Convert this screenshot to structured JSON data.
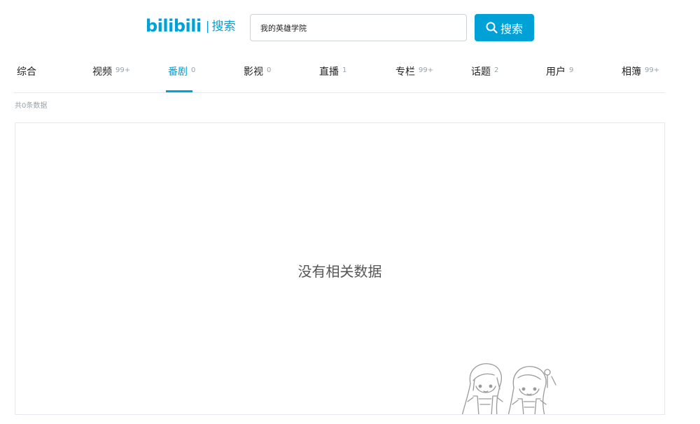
{
  "header": {
    "logo_text": "bilibili",
    "logo_separator": "|",
    "logo_sub": "搜索"
  },
  "search": {
    "value": "我的英雄学院",
    "button_label": "搜索"
  },
  "tabs": [
    {
      "label": "综合",
      "count": ""
    },
    {
      "label": "视频",
      "count": "99+"
    },
    {
      "label": "番剧",
      "count": "0"
    },
    {
      "label": "影视",
      "count": "0"
    },
    {
      "label": "直播",
      "count": "1"
    },
    {
      "label": "专栏",
      "count": "99+"
    },
    {
      "label": "话题",
      "count": "2"
    },
    {
      "label": "用户",
      "count": "9"
    },
    {
      "label": "相簿",
      "count": "99+"
    }
  ],
  "active_tab": "番剧",
  "result_count_text": "共0条数据",
  "empty_message": "没有相关数据",
  "icons": {
    "search_button": "search-icon",
    "mascot": "bilibili-mascot-illustration"
  },
  "colors": {
    "accent": "#00a1d6",
    "count_gray": "#99a2aa",
    "border": "#e5e9ef"
  }
}
